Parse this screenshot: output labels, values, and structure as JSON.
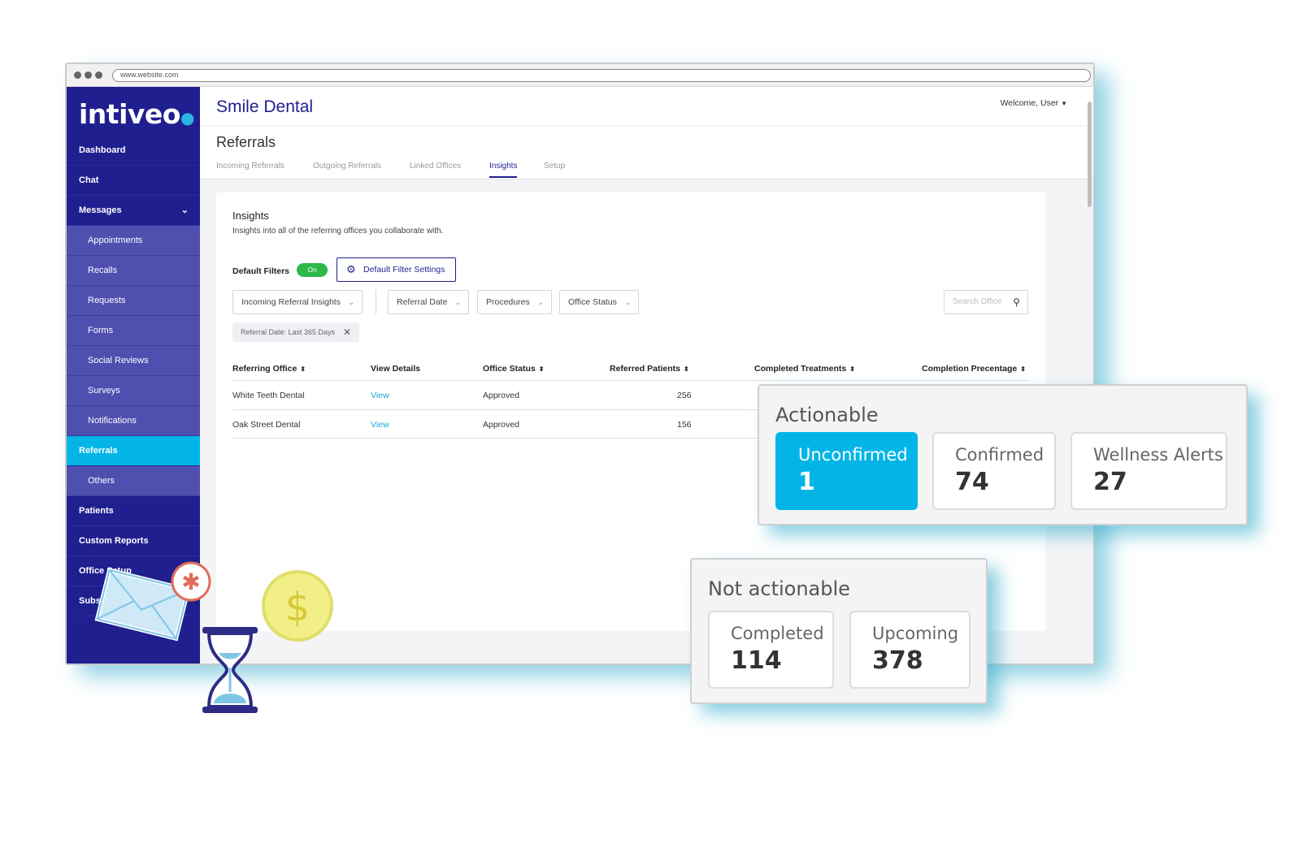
{
  "browser": {
    "url": "www.website.com"
  },
  "app": {
    "logo": "intiveo",
    "brand": "Smile Dental",
    "welcome": "Welcome, User",
    "page_title": "Referrals"
  },
  "sidebar": {
    "items": [
      {
        "label": "Dashboard"
      },
      {
        "label": "Chat"
      },
      {
        "label": "Messages"
      },
      {
        "label": "Appointments"
      },
      {
        "label": "Recalls"
      },
      {
        "label": "Requests"
      },
      {
        "label": "Forms"
      },
      {
        "label": "Social Reviews"
      },
      {
        "label": "Surveys"
      },
      {
        "label": "Notifications"
      },
      {
        "label": "Referrals"
      },
      {
        "label": "Others"
      },
      {
        "label": "Patients"
      },
      {
        "label": "Custom Reports"
      },
      {
        "label": "Office Setup"
      },
      {
        "label": "Subsc"
      }
    ]
  },
  "tabs": [
    {
      "label": "Incoming Referrals"
    },
    {
      "label": "Outgoing Referrals"
    },
    {
      "label": "Linked Offices"
    },
    {
      "label": "Insights"
    },
    {
      "label": "Setup"
    }
  ],
  "insights": {
    "title": "Insights",
    "subtitle": "Insights into all of the referring offices you collaborate with.",
    "default_filters_label": "Default Filters",
    "toggle": "On",
    "filter_settings_button": "Default Filter Settings",
    "selects": [
      {
        "label": "Incoming Referral Insights"
      },
      {
        "label": "Referral Date"
      },
      {
        "label": "Procedures"
      },
      {
        "label": "Office Status"
      }
    ],
    "search_placeholder": "Search Office",
    "chip": "Referral Date: Last 365 Days"
  },
  "table": {
    "headers": [
      "Referring Office",
      "View Details",
      "Office Status",
      "Referred Patients",
      "Completed Treatments",
      "Completion Precentage"
    ],
    "rows": [
      {
        "office": "White Teeth Dental",
        "details": "View",
        "status": "Approved",
        "referred": "256"
      },
      {
        "office": "Oak Street Dental",
        "details": "View",
        "status": "Approved",
        "referred": "156"
      }
    ]
  },
  "actionable": {
    "title": "Actionable",
    "stats": [
      {
        "label": "Unconfirmed",
        "value": "1"
      },
      {
        "label": "Confirmed",
        "value": "74"
      },
      {
        "label": "Wellness Alerts",
        "value": "27"
      }
    ]
  },
  "not_actionable": {
    "title": "Not actionable",
    "stats": [
      {
        "label": "Completed",
        "value": "114"
      },
      {
        "label": "Upcoming",
        "value": "378"
      }
    ]
  },
  "colors": {
    "sidebar": "#1f1f8f",
    "accent": "#03b5e6",
    "toggle_on": "#2eb84b",
    "link": "#1aa6d8"
  }
}
